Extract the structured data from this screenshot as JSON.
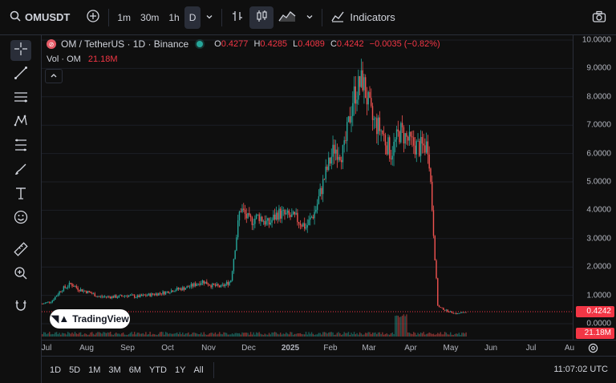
{
  "toolbar": {
    "symbol": "OMUSDT",
    "intervals": [
      "1m",
      "30m",
      "1h",
      "D"
    ],
    "active_interval": "D",
    "indicators_label": "Indicators"
  },
  "legend": {
    "title": "OM / TetherUS · 1D · Binance",
    "open_label": "O",
    "open": "0.4277",
    "high_label": "H",
    "high": "0.4285",
    "low_label": "L",
    "low": "0.4089",
    "close_label": "C",
    "close": "0.4242",
    "change": "−0.0035 (−0.82%)",
    "vol_label": "Vol · OM",
    "vol_value": "21.18M"
  },
  "price_axis": {
    "ticks": [
      "10.0000",
      "9.0000",
      "8.0000",
      "7.0000",
      "6.0000",
      "5.0000",
      "4.0000",
      "3.0000",
      "2.0000",
      "1.0000",
      "0.0000"
    ],
    "current_price": "0.4242",
    "current_volume": "21.18M"
  },
  "time_axis": {
    "ticks": [
      "Jul",
      "Aug",
      "Sep",
      "Oct",
      "Nov",
      "Dec",
      "2025",
      "Feb",
      "Mar",
      "Apr",
      "May",
      "Jun",
      "Jul",
      "Au"
    ]
  },
  "bottom": {
    "ranges": [
      "1D",
      "5D",
      "1M",
      "3M",
      "6M",
      "YTD",
      "1Y",
      "All"
    ],
    "clock": "11:07:02 UTC"
  },
  "watermark": "TradingView",
  "colors": {
    "up": "#26a69a",
    "down": "#ef5350",
    "price_label": "#f23645",
    "background": "#0f0f0f"
  },
  "chart_data": {
    "type": "candlestick",
    "title": "OM / TetherUS · 1D · Binance",
    "x": [
      "2024-06-24",
      "2024-07-01",
      "2024-07-08",
      "2024-07-15",
      "2024-07-22",
      "2024-07-29",
      "2024-08-05",
      "2024-08-12",
      "2024-08-19",
      "2024-08-26",
      "2024-09-02",
      "2024-09-09",
      "2024-09-16",
      "2024-09-23",
      "2024-09-30",
      "2024-10-07",
      "2024-10-14",
      "2024-10-21",
      "2024-10-28",
      "2024-11-04",
      "2024-11-11",
      "2024-11-18",
      "2024-11-25",
      "2024-12-02",
      "2024-12-09",
      "2024-12-16",
      "2024-12-23",
      "2024-12-30",
      "2025-01-06",
      "2025-01-13",
      "2025-01-20",
      "2025-01-27",
      "2025-02-03",
      "2025-02-10",
      "2025-02-17",
      "2025-02-24",
      "2025-03-03",
      "2025-03-10",
      "2025-03-17",
      "2025-03-24",
      "2025-03-31",
      "2025-04-07",
      "2025-04-14",
      "2025-04-21",
      "2025-04-28",
      "2025-05-05"
    ],
    "close": [
      0.7,
      0.8,
      1.2,
      1.4,
      1.2,
      1.1,
      0.95,
      0.95,
      0.95,
      1.0,
      0.95,
      1.0,
      1.05,
      1.1,
      1.2,
      1.25,
      1.35,
      1.5,
      1.35,
      1.3,
      1.5,
      4.1,
      3.6,
      3.8,
      3.5,
      3.9,
      3.8,
      3.7,
      3.4,
      4.0,
      5.2,
      6.2,
      6.0,
      8.0,
      8.6,
      7.2,
      6.8,
      6.0,
      6.8,
      6.4,
      6.2,
      6.3,
      0.6,
      0.45,
      0.35,
      0.42
    ],
    "ylim": [
      0,
      10
    ],
    "y_ticks": [
      0,
      1,
      2,
      3,
      4,
      5,
      6,
      7,
      8,
      9,
      10
    ],
    "last_price": 0.4242,
    "volume_last": "21.18M"
  }
}
